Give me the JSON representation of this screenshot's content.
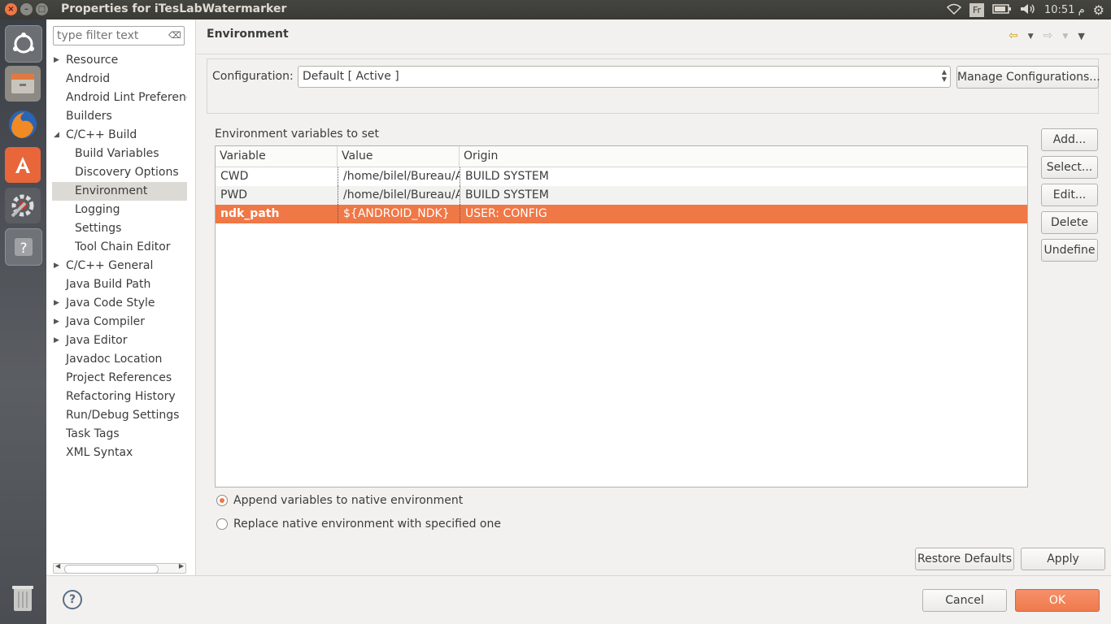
{
  "window": {
    "title": "Properties for iTesLabWatermarker",
    "controls": {
      "close": "×",
      "minimize": "–",
      "maximize": "□"
    }
  },
  "system_tray": {
    "keyboard_layout": "Fr",
    "time": "م 10:51",
    "icons": [
      "wifi-icon",
      "battery-icon",
      "volume-icon",
      "settings-gear-icon"
    ]
  },
  "launcher": {
    "items": [
      "ubuntu-dash-icon",
      "files-icon",
      "firefox-icon",
      "software-center-icon",
      "system-settings-icon",
      "help-icon",
      "trash-icon"
    ]
  },
  "nav": {
    "filter_placeholder": "type filter text",
    "items": [
      {
        "label": "Resource",
        "expandable": true,
        "level": 0
      },
      {
        "label": "Android",
        "expandable": false,
        "level": 0
      },
      {
        "label": "Android Lint Preferences",
        "expandable": false,
        "level": 0
      },
      {
        "label": "Builders",
        "expandable": false,
        "level": 0
      },
      {
        "label": "C/C++ Build",
        "expandable": true,
        "expanded": true,
        "level": 0
      },
      {
        "label": "Build Variables",
        "level": 1
      },
      {
        "label": "Discovery Options",
        "level": 1
      },
      {
        "label": "Environment",
        "level": 1,
        "selected": true
      },
      {
        "label": "Logging",
        "level": 1
      },
      {
        "label": "Settings",
        "level": 1
      },
      {
        "label": "Tool Chain Editor",
        "level": 1
      },
      {
        "label": "C/C++ General",
        "expandable": true,
        "level": 0
      },
      {
        "label": "Java Build Path",
        "level": 0
      },
      {
        "label": "Java Code Style",
        "expandable": true,
        "level": 0
      },
      {
        "label": "Java Compiler",
        "expandable": true,
        "level": 0
      },
      {
        "label": "Java Editor",
        "expandable": true,
        "level": 0
      },
      {
        "label": "Javadoc Location",
        "level": 0
      },
      {
        "label": "Project References",
        "level": 0
      },
      {
        "label": "Refactoring History",
        "level": 0
      },
      {
        "label": "Run/Debug Settings",
        "level": 0
      },
      {
        "label": "Task Tags",
        "level": 0
      },
      {
        "label": "XML Syntax",
        "level": 0
      }
    ]
  },
  "page": {
    "title": "Environment",
    "configuration_label": "Configuration:",
    "configuration_value": "Default  [ Active ]",
    "manage_button": "Manage Configurations...",
    "envvars_label": "Environment variables to set",
    "columns": [
      "Variable",
      "Value",
      "Origin"
    ],
    "rows": [
      {
        "variable": "CWD",
        "value": "/home/bilel/Bureau/A",
        "origin": "BUILD SYSTEM"
      },
      {
        "variable": "PWD",
        "value": "/home/bilel/Bureau/A",
        "origin": "BUILD SYSTEM"
      },
      {
        "variable": "ndk_path",
        "value": "${ANDROID_NDK}",
        "origin": "USER: CONFIG",
        "selected": true
      }
    ],
    "side_buttons": [
      "Add...",
      "Select...",
      "Edit...",
      "Delete",
      "Undefine"
    ],
    "radio_append": "Append variables to native environment",
    "radio_replace": "Replace native environment with specified one",
    "append_selected": true,
    "restore_defaults": "Restore Defaults",
    "apply": "Apply"
  },
  "footer": {
    "help": "?",
    "cancel": "Cancel",
    "ok": "OK"
  },
  "colors": {
    "accent": "#f07746",
    "selection_nav": "#dcdad5",
    "panel": "#3a3a36"
  }
}
